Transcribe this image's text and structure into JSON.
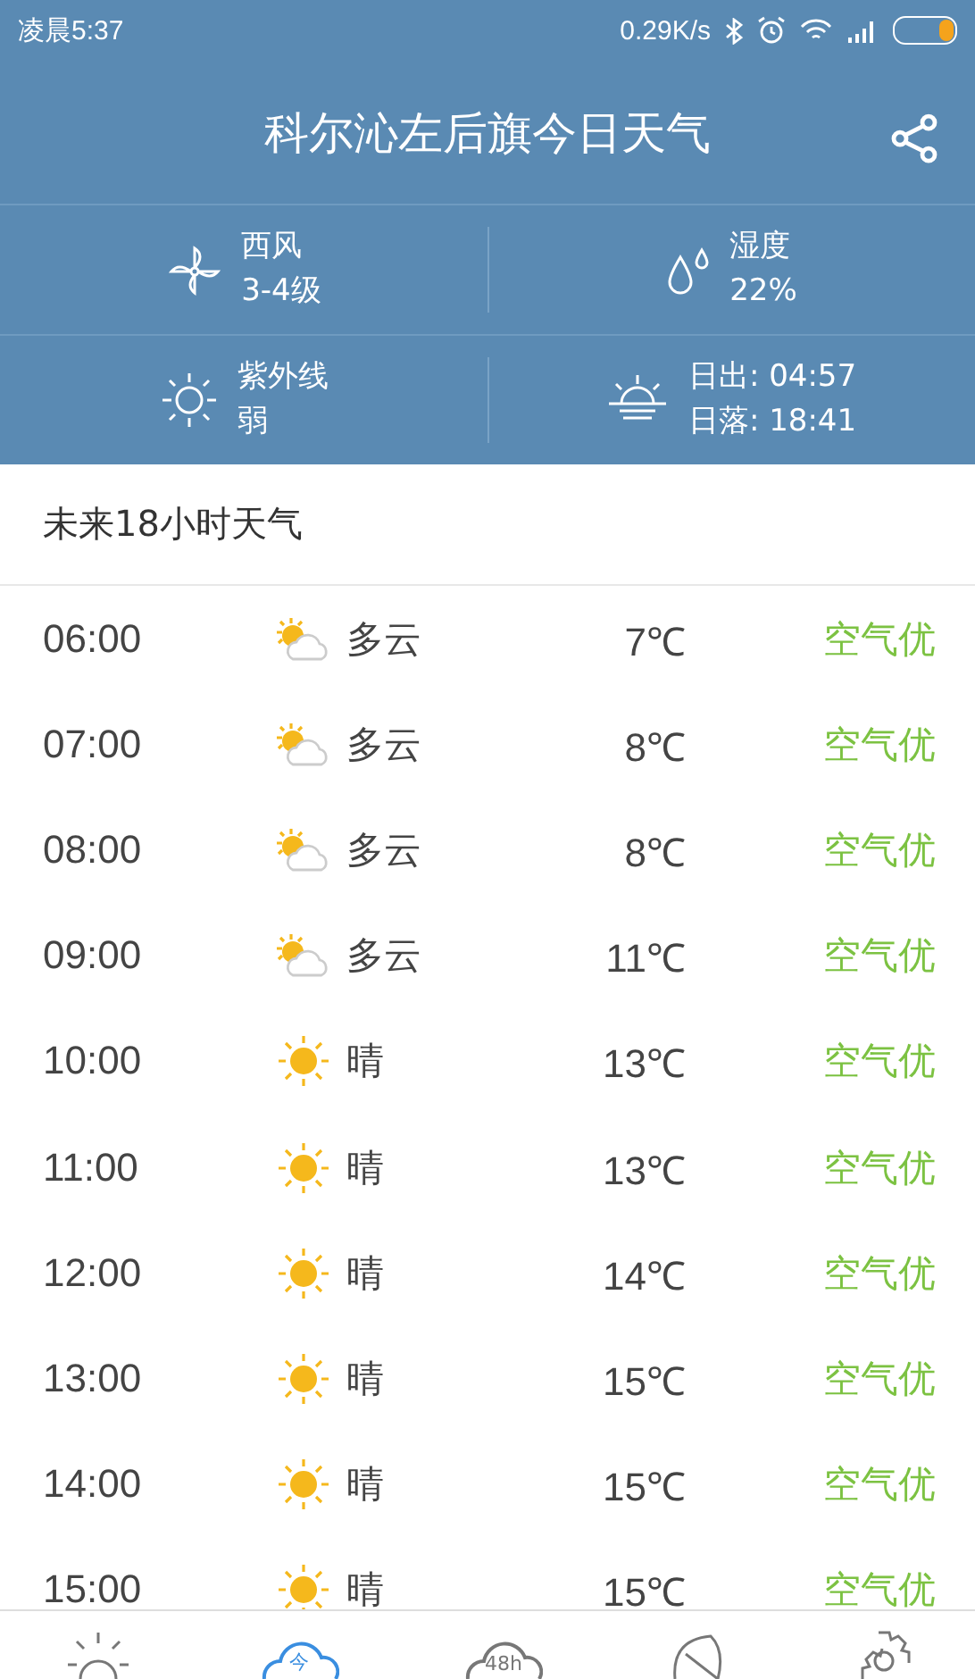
{
  "status_bar": {
    "time": "凌晨5:37",
    "speed": "0.29K/s"
  },
  "header": {
    "title": "科尔沁左后旗今日天气"
  },
  "details": [
    {
      "kind": "wind",
      "label": "西风",
      "value": "3-4级"
    },
    {
      "kind": "humidity",
      "label": "湿度",
      "value": "22%"
    },
    {
      "kind": "uv",
      "label": "紫外线",
      "value": "弱"
    },
    {
      "kind": "sun",
      "label": "日出: 04:57",
      "value": "日落: 18:41"
    }
  ],
  "section_title": "未来18小时天气",
  "hours": [
    {
      "time": "06:00",
      "kind": "cloudy",
      "condition": "多云",
      "temp": "7℃",
      "air": "空气优"
    },
    {
      "time": "07:00",
      "kind": "cloudy",
      "condition": "多云",
      "temp": "8℃",
      "air": "空气优"
    },
    {
      "time": "08:00",
      "kind": "cloudy",
      "condition": "多云",
      "temp": "8℃",
      "air": "空气优"
    },
    {
      "time": "09:00",
      "kind": "cloudy",
      "condition": "多云",
      "temp": "11℃",
      "air": "空气优"
    },
    {
      "time": "10:00",
      "kind": "sunny",
      "condition": "晴",
      "temp": "13℃",
      "air": "空气优"
    },
    {
      "time": "11:00",
      "kind": "sunny",
      "condition": "晴",
      "temp": "13℃",
      "air": "空气优"
    },
    {
      "time": "12:00",
      "kind": "sunny",
      "condition": "晴",
      "temp": "14℃",
      "air": "空气优"
    },
    {
      "time": "13:00",
      "kind": "sunny",
      "condition": "晴",
      "temp": "15℃",
      "air": "空气优"
    },
    {
      "time": "14:00",
      "kind": "sunny",
      "condition": "晴",
      "temp": "15℃",
      "air": "空气优"
    },
    {
      "time": "15:00",
      "kind": "sunny",
      "condition": "晴",
      "temp": "15℃",
      "air": "空气优"
    }
  ],
  "nav": [
    {
      "kind": "sun",
      "selected": false
    },
    {
      "kind": "cloud",
      "text": "今",
      "selected": true
    },
    {
      "kind": "cloud",
      "text": "48h",
      "selected": false
    },
    {
      "kind": "leaf",
      "selected": false
    },
    {
      "kind": "gear",
      "selected": false
    }
  ]
}
